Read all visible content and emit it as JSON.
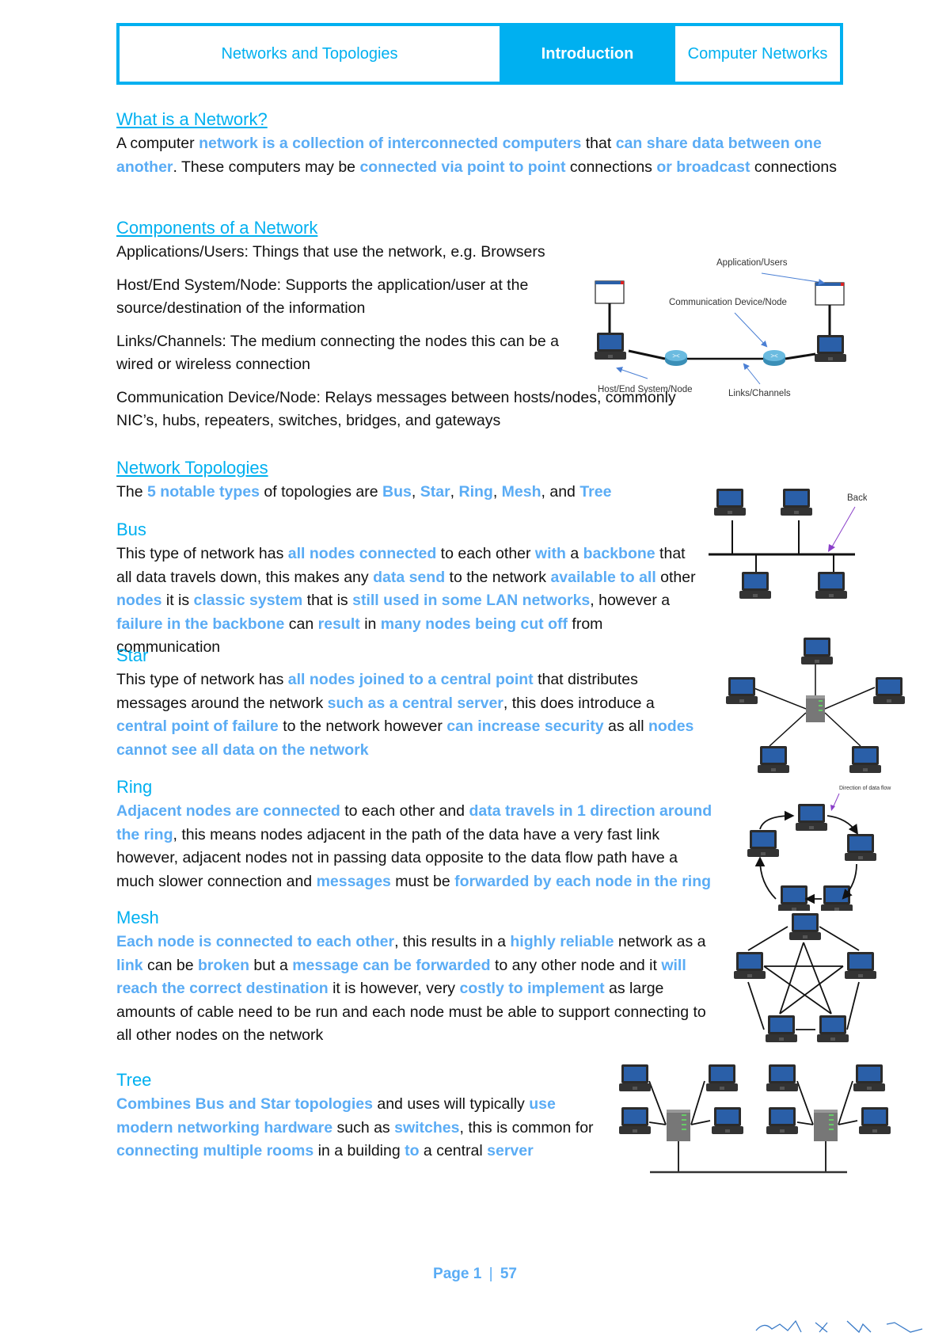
{
  "header": {
    "left": "Networks and Topologies",
    "center": "Introduction",
    "right": "Computer Networks"
  },
  "what_is": {
    "title": "What is a Network?",
    "segments": [
      {
        "t": "A computer ",
        "h": false
      },
      {
        "t": "network is a collection of interconnected computers",
        "h": true
      },
      {
        "t": " that ",
        "h": false
      },
      {
        "t": "can share data between one another",
        "h": true
      },
      {
        "t": ". These computers may be ",
        "h": false
      },
      {
        "t": "connected via point to point",
        "h": true
      },
      {
        "t": " connections ",
        "h": false
      },
      {
        "t": "or broadcast",
        "h": true
      },
      {
        "t": " connections",
        "h": false
      }
    ]
  },
  "components": {
    "title": "Components of a Network",
    "items": [
      "Applications/Users: Things that use the network, e.g. Browsers",
      "Host/End System/Node: Supports the application/user at the source/destination of the information",
      "Links/Channels: The medium connecting the nodes this can be a wired or wireless connection",
      "Communication Device/Node: Relays messages between hosts/nodes, commonly NIC’s, hubs, repeaters, switches, bridges, and gateways"
    ],
    "diagram_labels": {
      "app": "Application/Users",
      "comm": "Communication Device/Node",
      "host": "Host/End System/Node",
      "links": "Links/Channels"
    }
  },
  "topologies": {
    "title": "Network Topologies",
    "intro": [
      {
        "t": "The ",
        "h": false
      },
      {
        "t": "5 notable types",
        "h": true
      },
      {
        "t": " of topologies are ",
        "h": false
      },
      {
        "t": "Bus",
        "h": true
      },
      {
        "t": ", ",
        "h": false
      },
      {
        "t": "Star",
        "h": true
      },
      {
        "t": ", ",
        "h": false
      },
      {
        "t": "Ring",
        "h": true
      },
      {
        "t": ", ",
        "h": false
      },
      {
        "t": "Mesh",
        "h": true
      },
      {
        "t": ", and ",
        "h": false
      },
      {
        "t": "Tree",
        "h": true
      }
    ]
  },
  "bus": {
    "title": "Bus",
    "label": "Backbone",
    "segments": [
      {
        "t": "This type of network has ",
        "h": false
      },
      {
        "t": "all nodes connected",
        "h": true
      },
      {
        "t": " to each other ",
        "h": false
      },
      {
        "t": "with",
        "h": true
      },
      {
        "t": " a ",
        "h": false
      },
      {
        "t": "backbone",
        "h": true
      },
      {
        "t": " that all data travels down, this makes any ",
        "h": false
      },
      {
        "t": "data send",
        "h": true
      },
      {
        "t": " to the network ",
        "h": false
      },
      {
        "t": "available to all",
        "h": true
      },
      {
        "t": " other ",
        "h": false
      },
      {
        "t": "nodes",
        "h": true
      },
      {
        "t": " it is ",
        "h": false
      },
      {
        "t": "classic system",
        "h": true
      },
      {
        "t": " that is ",
        "h": false
      },
      {
        "t": "still used in some LAN networks",
        "h": true
      },
      {
        "t": ", however a ",
        "h": false
      },
      {
        "t": "failure in the backbone",
        "h": true
      },
      {
        "t": " can ",
        "h": false
      },
      {
        "t": "result",
        "h": true
      },
      {
        "t": " in ",
        "h": false
      },
      {
        "t": "many nodes being cut off",
        "h": true
      },
      {
        "t": " from communication",
        "h": false
      }
    ]
  },
  "star": {
    "title": "Star",
    "segments": [
      {
        "t": "This type of network has ",
        "h": false
      },
      {
        "t": "all nodes joined to a central point",
        "h": true
      },
      {
        "t": " that distributes messages around the network ",
        "h": false
      },
      {
        "t": "such as a central server",
        "h": true
      },
      {
        "t": ", this does introduce a ",
        "h": false
      },
      {
        "t": "central point of failure",
        "h": true
      },
      {
        "t": " to the network however ",
        "h": false
      },
      {
        "t": "can increase security",
        "h": true
      },
      {
        "t": " as all ",
        "h": false
      },
      {
        "t": "nodes cannot see all data on the network",
        "h": true
      }
    ]
  },
  "ring": {
    "title": "Ring",
    "label": "Direction of data flow",
    "segments": [
      {
        "t": "Adjacent nodes are connected",
        "h": true
      },
      {
        "t": " to each other and ",
        "h": false
      },
      {
        "t": "data travels in 1 direction around the ring",
        "h": true
      },
      {
        "t": ", this means nodes adjacent in the path of the data have a very fast link however, adjacent nodes not in passing data opposite to the data flow path have a much slower connection and ",
        "h": false
      },
      {
        "t": "messages",
        "h": true
      },
      {
        "t": " must be ",
        "h": false
      },
      {
        "t": "forwarded by each node in the ring",
        "h": true
      }
    ]
  },
  "mesh": {
    "title": "Mesh",
    "segments": [
      {
        "t": "Each node is connected to each other",
        "h": true
      },
      {
        "t": ", this results in a ",
        "h": false
      },
      {
        "t": "highly reliable",
        "h": true
      },
      {
        "t": " network as a ",
        "h": false
      },
      {
        "t": "link",
        "h": true
      },
      {
        "t": " can be ",
        "h": false
      },
      {
        "t": "broken",
        "h": true
      },
      {
        "t": " but a ",
        "h": false
      },
      {
        "t": "message can be forwarded",
        "h": true
      },
      {
        "t": " to any other node and it ",
        "h": false
      },
      {
        "t": "will reach the correct destination",
        "h": true
      },
      {
        "t": " it is however, very ",
        "h": false
      },
      {
        "t": "costly to implement",
        "h": true
      },
      {
        "t": " as large amounts of cable need to be run and each node must be able to support connecting to all other nodes on the network",
        "h": false
      }
    ]
  },
  "tree": {
    "title": "Tree",
    "segments": [
      {
        "t": "Combines Bus and Star topologies",
        "h": true
      },
      {
        "t": " and uses will typically ",
        "h": false
      },
      {
        "t": "use modern networking hardware",
        "h": true
      },
      {
        "t": " such as ",
        "h": false
      },
      {
        "t": "switches",
        "h": true
      },
      {
        "t": ", this is common for ",
        "h": false
      },
      {
        "t": "connecting multiple rooms",
        "h": true
      },
      {
        "t": " in a building ",
        "h": false
      },
      {
        "t": "to",
        "h": true
      },
      {
        "t": " a central ",
        "h": false
      },
      {
        "t": "server",
        "h": true
      }
    ]
  },
  "footer": {
    "page": "Page 1",
    "sep": "|",
    "total": "57"
  },
  "colors": {
    "accent": "#00b0f0",
    "highlight": "#5aacf5"
  }
}
